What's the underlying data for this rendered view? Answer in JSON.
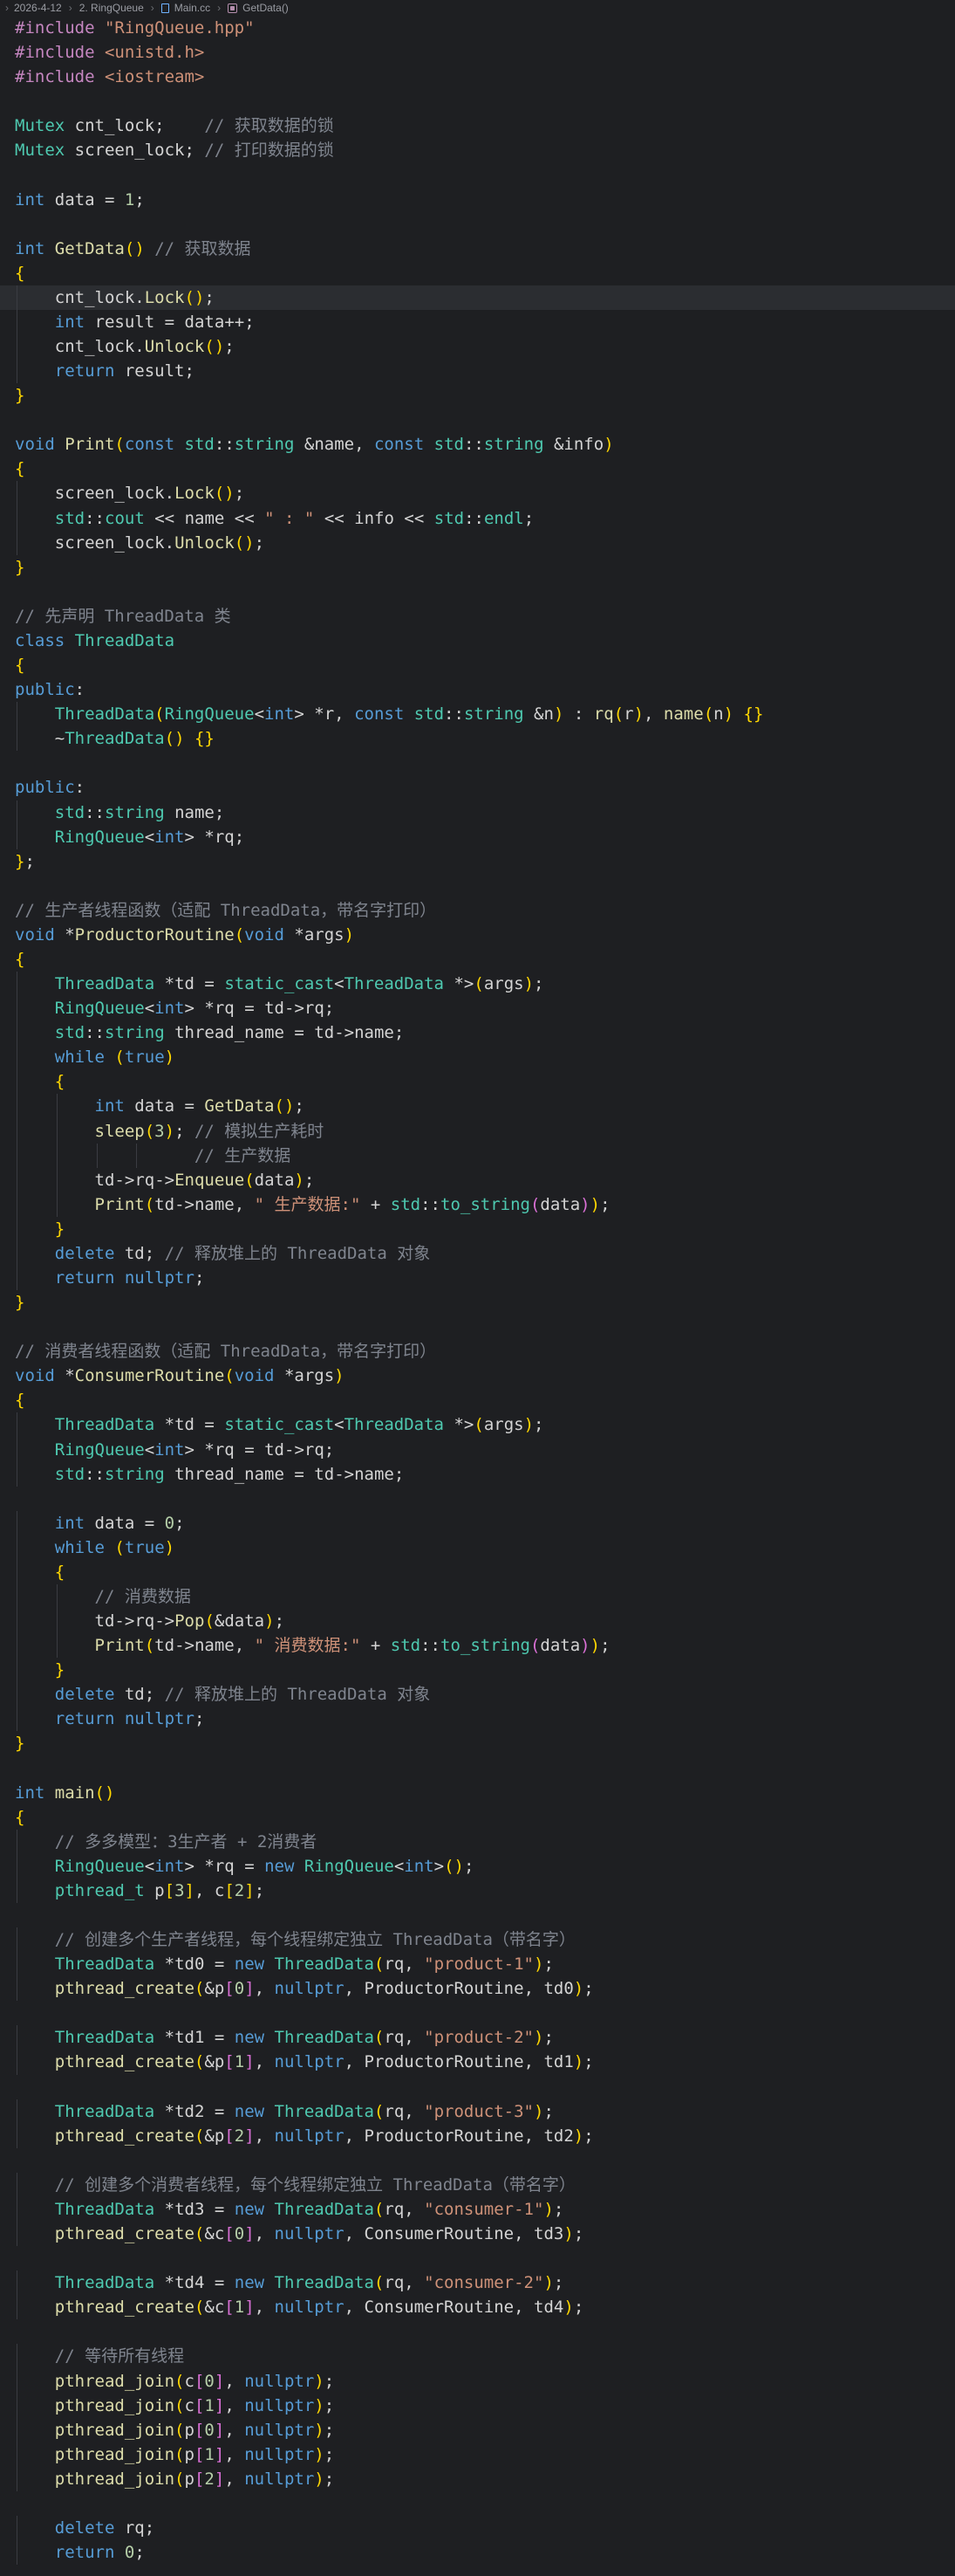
{
  "breadcrumb": {
    "folder1": "2026-4-12",
    "folder2": "2. RingQueue",
    "file": "Main.cc",
    "symbol": "GetData()"
  },
  "editor": {
    "current_line": 12,
    "lines": [
      "#include \"RingQueue.hpp\"",
      "#include <unistd.h>",
      "#include <iostream>",
      "",
      "Mutex cnt_lock;    // 获取数据的锁",
      "Mutex screen_lock; // 打印数据的锁",
      "",
      "int data = 1;",
      "",
      "int GetData() // 获取数据",
      "{",
      "    cnt_lock.Lock();",
      "    int result = data++;",
      "    cnt_lock.Unlock();",
      "    return result;",
      "}",
      "",
      "void Print(const std::string &name, const std::string &info)",
      "{",
      "    screen_lock.Lock();",
      "    std::cout << name << \" : \" << info << std::endl;",
      "    screen_lock.Unlock();",
      "}",
      "",
      "// 先声明 ThreadData 类",
      "class ThreadData",
      "{",
      "public:",
      "    ThreadData(RingQueue<int> *r, const std::string &n) : rq(r), name(n) {}",
      "    ~ThreadData() {}",
      "",
      "public:",
      "    std::string name;",
      "    RingQueue<int> *rq;",
      "};",
      "",
      "// 生产者线程函数（适配 ThreadData，带名字打印）",
      "void *ProductorRoutine(void *args)",
      "{",
      "    ThreadData *td = static_cast<ThreadData *>(args);",
      "    RingQueue<int> *rq = td->rq;",
      "    std::string thread_name = td->name;",
      "    while (true)",
      "    {",
      "        int data = GetData();",
      "        sleep(3); // 模拟生产耗时",
      "                  // 生产数据",
      "        td->rq->Enqueue(data);",
      "        Print(td->name, \" 生产数据:\" + std::to_string(data));",
      "    }",
      "    delete td; // 释放堆上的 ThreadData 对象",
      "    return nullptr;",
      "}",
      "",
      "// 消费者线程函数（适配 ThreadData，带名字打印）",
      "void *ConsumerRoutine(void *args)",
      "{",
      "    ThreadData *td = static_cast<ThreadData *>(args);",
      "    RingQueue<int> *rq = td->rq;",
      "    std::string thread_name = td->name;",
      "",
      "    int data = 0;",
      "    while (true)",
      "    {",
      "        // 消费数据",
      "        td->rq->Pop(&data);",
      "        Print(td->name, \" 消费数据:\" + std::to_string(data));",
      "    }",
      "    delete td; // 释放堆上的 ThreadData 对象",
      "    return nullptr;",
      "}",
      "",
      "int main()",
      "{",
      "    // 多多模型：3生产者 + 2消费者",
      "    RingQueue<int> *rq = new RingQueue<int>();",
      "    pthread_t p[3], c[2];",
      "",
      "    // 创建多个生产者线程，每个线程绑定独立 ThreadData（带名字）",
      "    ThreadData *td0 = new ThreadData(rq, \"product-1\");",
      "    pthread_create(&p[0], nullptr, ProductorRoutine, td0);",
      "",
      "    ThreadData *td1 = new ThreadData(rq, \"product-2\");",
      "    pthread_create(&p[1], nullptr, ProductorRoutine, td1);",
      "",
      "    ThreadData *td2 = new ThreadData(rq, \"product-3\");",
      "    pthread_create(&p[2], nullptr, ProductorRoutine, td2);",
      "",
      "    // 创建多个消费者线程，每个线程绑定独立 ThreadData（带名字）",
      "    ThreadData *td3 = new ThreadData(rq, \"consumer-1\");",
      "    pthread_create(&c[0], nullptr, ConsumerRoutine, td3);",
      "",
      "    ThreadData *td4 = new ThreadData(rq, \"consumer-2\");",
      "    pthread_create(&c[1], nullptr, ConsumerRoutine, td4);",
      "",
      "    // 等待所有线程",
      "    pthread_join(c[0], nullptr);",
      "    pthread_join(c[1], nullptr);",
      "    pthread_join(p[0], nullptr);",
      "    pthread_join(p[1], nullptr);",
      "    pthread_join(p[2], nullptr);",
      "",
      "    delete rq;",
      "    return 0;"
    ]
  }
}
